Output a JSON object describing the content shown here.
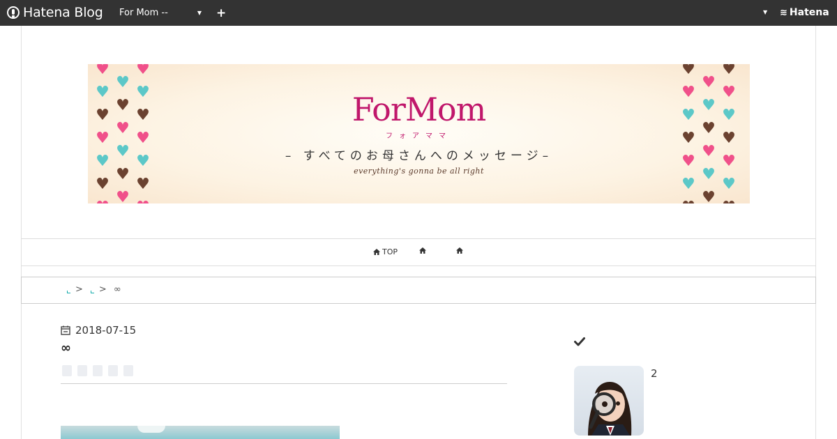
{
  "topbar": {
    "logo_text": "Hatena Blog",
    "blog_selector": "For Mom --",
    "add_label": "+",
    "service_label": "Hatena"
  },
  "banner": {
    "title": "ForMom",
    "kana": "フォアママ",
    "message": "– すべてのお母さんへのメッセージ–",
    "tagline": "everything's gonna be all right",
    "colors": {
      "title": "#c0176b",
      "pink": "#f0508a",
      "teal": "#5cc8c8",
      "brown": "#6b4230"
    }
  },
  "nav": {
    "items": [
      {
        "label": "TOP",
        "icon": "home-icon"
      },
      {
        "label": "",
        "icon": "home-icon"
      },
      {
        "label": "",
        "icon": "home-icon"
      }
    ]
  },
  "breadcrumb": {
    "separator": ">",
    "current": "∞"
  },
  "entry": {
    "date": "2018-07-15",
    "title": "∞",
    "tag_count": 5
  },
  "sidebar": {
    "check_icon": "check-icon",
    "count": "2"
  }
}
